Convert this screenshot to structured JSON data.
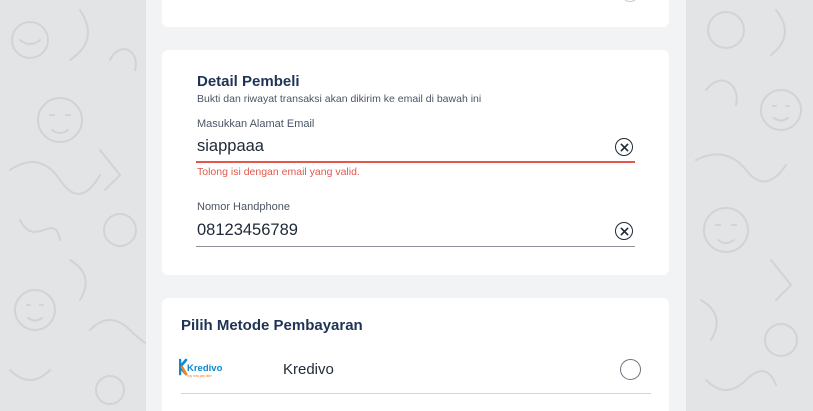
{
  "buyer": {
    "title": "Detail Pembeli",
    "subtitle": "Bukti dan riwayat transaksi akan dikirim ke email di bawah ini",
    "email": {
      "label": "Masukkan Alamat Email",
      "value": "siappaaa",
      "error": "Tolong isi dengan email yang valid."
    },
    "phone": {
      "label": "Nomor Handphone",
      "value": "08123456789"
    }
  },
  "payment": {
    "title": "Pilih Metode Pembayaran",
    "methods": [
      {
        "name": "Kredivo",
        "logo_text": "Kredivo",
        "logo_tagline": "buy now pay later",
        "selected": false
      }
    ]
  },
  "colors": {
    "navy": "#1f3354",
    "error": "#e2594c",
    "kredivo_blue": "#0a8bcf",
    "kredivo_orange": "#f58220"
  },
  "icons": {
    "clear": "clear-circle-x-icon",
    "logo": "kredivo-logo-icon"
  }
}
